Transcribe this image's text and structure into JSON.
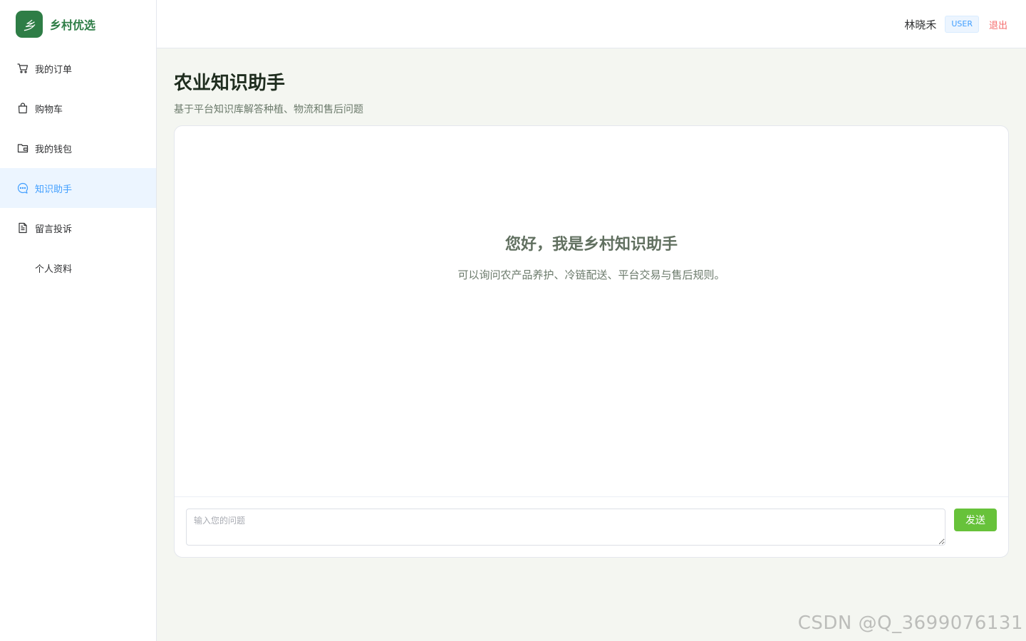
{
  "app": {
    "logo_glyph": "乡",
    "logo_text": "乡村优选",
    "brand_color": "#2e7d46"
  },
  "sidebar": {
    "items": [
      {
        "label": "我的订单",
        "icon": "cart-icon",
        "active": false
      },
      {
        "label": "购物车",
        "icon": "shopping-bag-icon",
        "active": false
      },
      {
        "label": "我的钱包",
        "icon": "wallet-icon",
        "active": false
      },
      {
        "label": "知识助手",
        "icon": "chat-bubble-icon",
        "active": true
      },
      {
        "label": "留言投诉",
        "icon": "document-icon",
        "active": false
      },
      {
        "label": "个人资料",
        "icon": "",
        "active": false
      }
    ]
  },
  "header": {
    "user_name": "林晓禾",
    "role": "USER",
    "logout_label": "退出"
  },
  "page": {
    "title": "农业知识助手",
    "subtitle": "基于平台知识库解答种植、物流和售后问题"
  },
  "chat": {
    "welcome_title": "您好，我是乡村知识助手",
    "welcome_text": "可以询问农产品养护、冷链配送、平台交易与售后规则。",
    "input_value": "",
    "input_placeholder": "输入您的问题",
    "send_label": "发送"
  },
  "watermark": "CSDN @Q_3699076131",
  "colors": {
    "active_menu_bg": "#ecf5ff",
    "active_menu_text": "#409eff",
    "send_button": "#67c23a",
    "logout_text": "#f56c6c"
  }
}
